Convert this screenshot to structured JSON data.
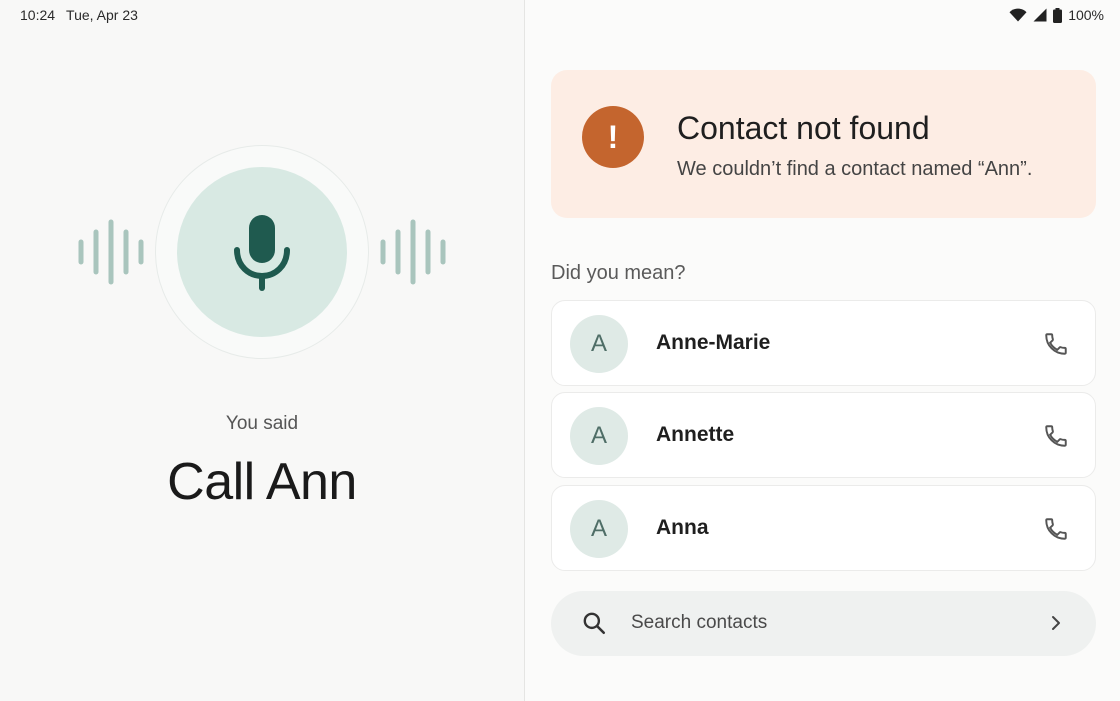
{
  "status_bar": {
    "time": "10:24",
    "date": "Tue, Apr 23",
    "battery": "100%"
  },
  "voice": {
    "you_said_label": "You said",
    "transcript": "Call Ann"
  },
  "error": {
    "icon": "!",
    "title": "Contact not found",
    "description": "We couldn’t find a contact named “Ann”."
  },
  "suggestions": {
    "heading": "Did you mean?",
    "contacts": [
      {
        "initial": "A",
        "name": "Anne-Marie"
      },
      {
        "initial": "A",
        "name": "Annette"
      },
      {
        "initial": "A",
        "name": "Anna"
      }
    ]
  },
  "search": {
    "label": "Search contacts"
  },
  "colors": {
    "accent": "#1f5a4f",
    "error": "#c4652e",
    "error_bg": "#fdede4",
    "mic_bg": "#d8e9e3"
  }
}
